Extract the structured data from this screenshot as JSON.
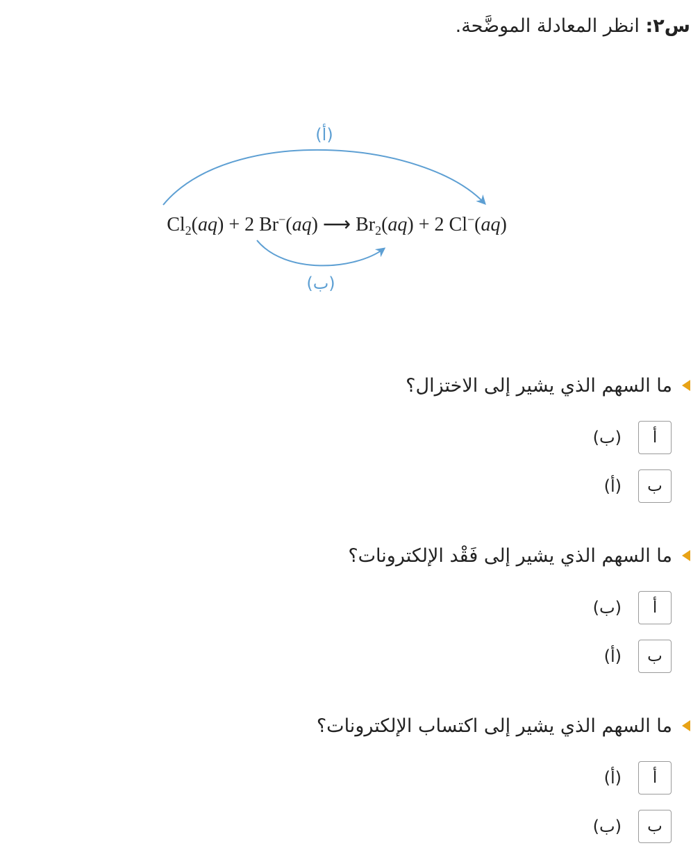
{
  "header": {
    "number": "س٢:",
    "text": " انظر المعادلة الموضَّحة."
  },
  "diagram": {
    "arrow_a_label": "(أ)",
    "arrow_b_label": "(ب)",
    "arrow_color": "#5d9fd3",
    "equation": {
      "cl": "Cl",
      "sub2": "2",
      "aq": "aq",
      "lparen": "(",
      "rparen": ")",
      "plus": "+",
      "two": "2",
      "br": "Br",
      "minus": "−",
      "arrow": "⟶",
      "cl_ion": "Cl"
    }
  },
  "parts": [
    {
      "question": "ما السهم الذي يشير إلى الاختزال؟",
      "options": [
        {
          "letter": "أ",
          "text": "(ب)"
        },
        {
          "letter": "ب",
          "text": "(أ)"
        }
      ]
    },
    {
      "question": "ما السهم الذي يشير إلى فَقْد الإلكترونات؟",
      "options": [
        {
          "letter": "أ",
          "text": "(ب)"
        },
        {
          "letter": "ب",
          "text": "(أ)"
        }
      ]
    },
    {
      "question": "ما السهم الذي يشير إلى اكتساب الإلكترونات؟",
      "options": [
        {
          "letter": "أ",
          "text": "(أ)"
        },
        {
          "letter": "ب",
          "text": "(ب)"
        }
      ]
    }
  ],
  "colors": {
    "bullet": "#e8a317",
    "arrow": "#5d9fd3"
  }
}
